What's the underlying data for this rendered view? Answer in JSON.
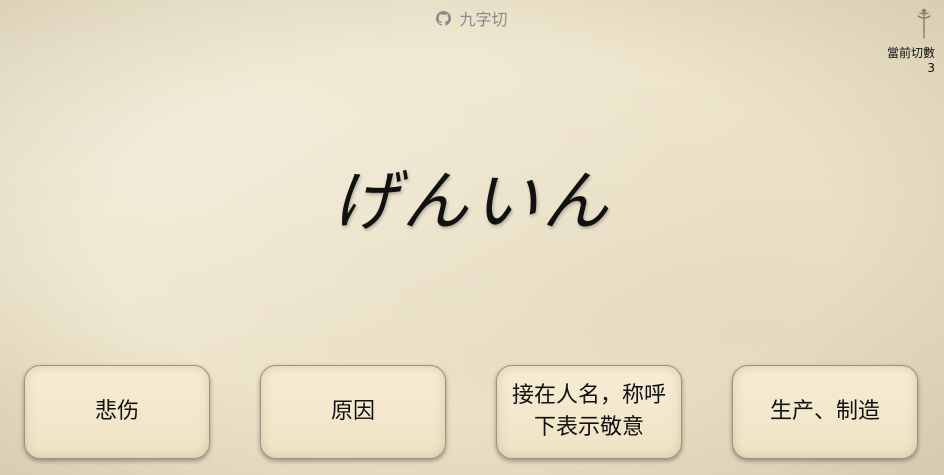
{
  "header": {
    "title": "九字切",
    "icon": "github-icon"
  },
  "counter": {
    "label": "當前切數",
    "value": "3"
  },
  "question": {
    "kana": "げんいん"
  },
  "options": [
    {
      "label": "悲伤"
    },
    {
      "label": "原因"
    },
    {
      "label": "接在人名，称呼下表示敬意"
    },
    {
      "label": "生产、制造"
    }
  ]
}
